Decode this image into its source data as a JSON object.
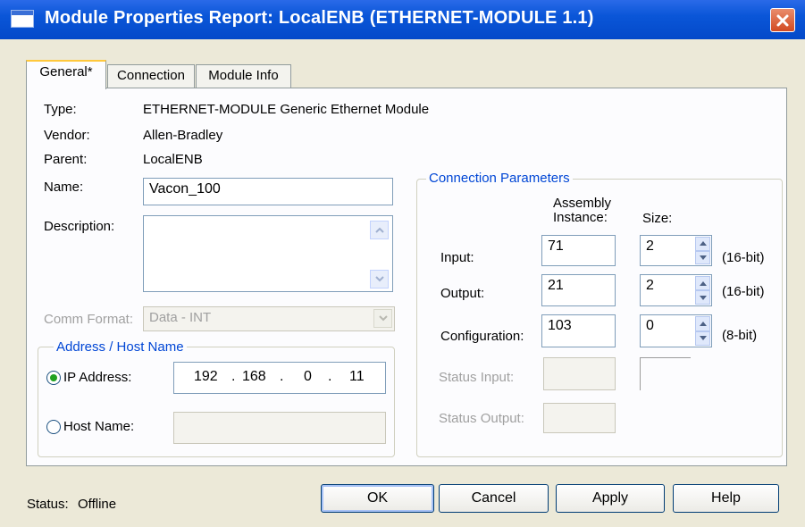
{
  "window": {
    "title": "Module Properties Report: LocalENB (ETHERNET-MODULE 1.1)"
  },
  "tabs": [
    {
      "label": "General*",
      "active": true
    },
    {
      "label": "Connection",
      "active": false
    },
    {
      "label": "Module Info",
      "active": false
    }
  ],
  "general": {
    "type_label": "Type:",
    "type_value": "ETHERNET-MODULE Generic Ethernet Module",
    "vendor_label": "Vendor:",
    "vendor_value": "Allen-Bradley",
    "parent_label": "Parent:",
    "parent_value": "LocalENB",
    "name_label": "Name:",
    "name_value": "Vacon_100",
    "description_label": "Description:",
    "description_value": "",
    "comm_format_label": "Comm Format:",
    "comm_format_value": "Data - INT"
  },
  "address": {
    "group_title": "Address / Host Name",
    "ip_label": "IP Address:",
    "ip_selected": true,
    "ip_octets": [
      "192",
      "168",
      "0",
      "11"
    ],
    "ip_sep": ".",
    "host_label": "Host Name:",
    "host_value": ""
  },
  "connection_parameters": {
    "group_title": "Connection Parameters",
    "col_assembly": "Assembly Instance:",
    "col_assembly_line1": "Assembly",
    "col_assembly_line2": "Instance:",
    "col_size": "Size:",
    "rows": [
      {
        "label": "Input:",
        "instance": "71",
        "size": "2",
        "unit": "(16-bit)"
      },
      {
        "label": "Output:",
        "instance": "21",
        "size": "2",
        "unit": "(16-bit)"
      },
      {
        "label": "Configuration:",
        "instance": "103",
        "size": "0",
        "unit": "(8-bit)"
      }
    ],
    "status_input_label": "Status Input:",
    "status_output_label": "Status Output:"
  },
  "footer": {
    "status_label": "Status:",
    "status_value": "Offline",
    "ok_label": "OK",
    "cancel_label": "Cancel",
    "apply_label": "Apply",
    "help_label": "Help"
  },
  "icons": [
    "window-icon",
    "close-icon",
    "scroll-up-icon",
    "scroll-down-icon",
    "dropdown-arrow-icon",
    "spin-up-icon",
    "spin-down-icon"
  ],
  "colors": {
    "titlebar": "#0a56d8",
    "close": "#d24a22",
    "group_title": "#0046d5",
    "dialog_bg": "#ece9d8",
    "tab_highlight": "#ffc83c"
  }
}
